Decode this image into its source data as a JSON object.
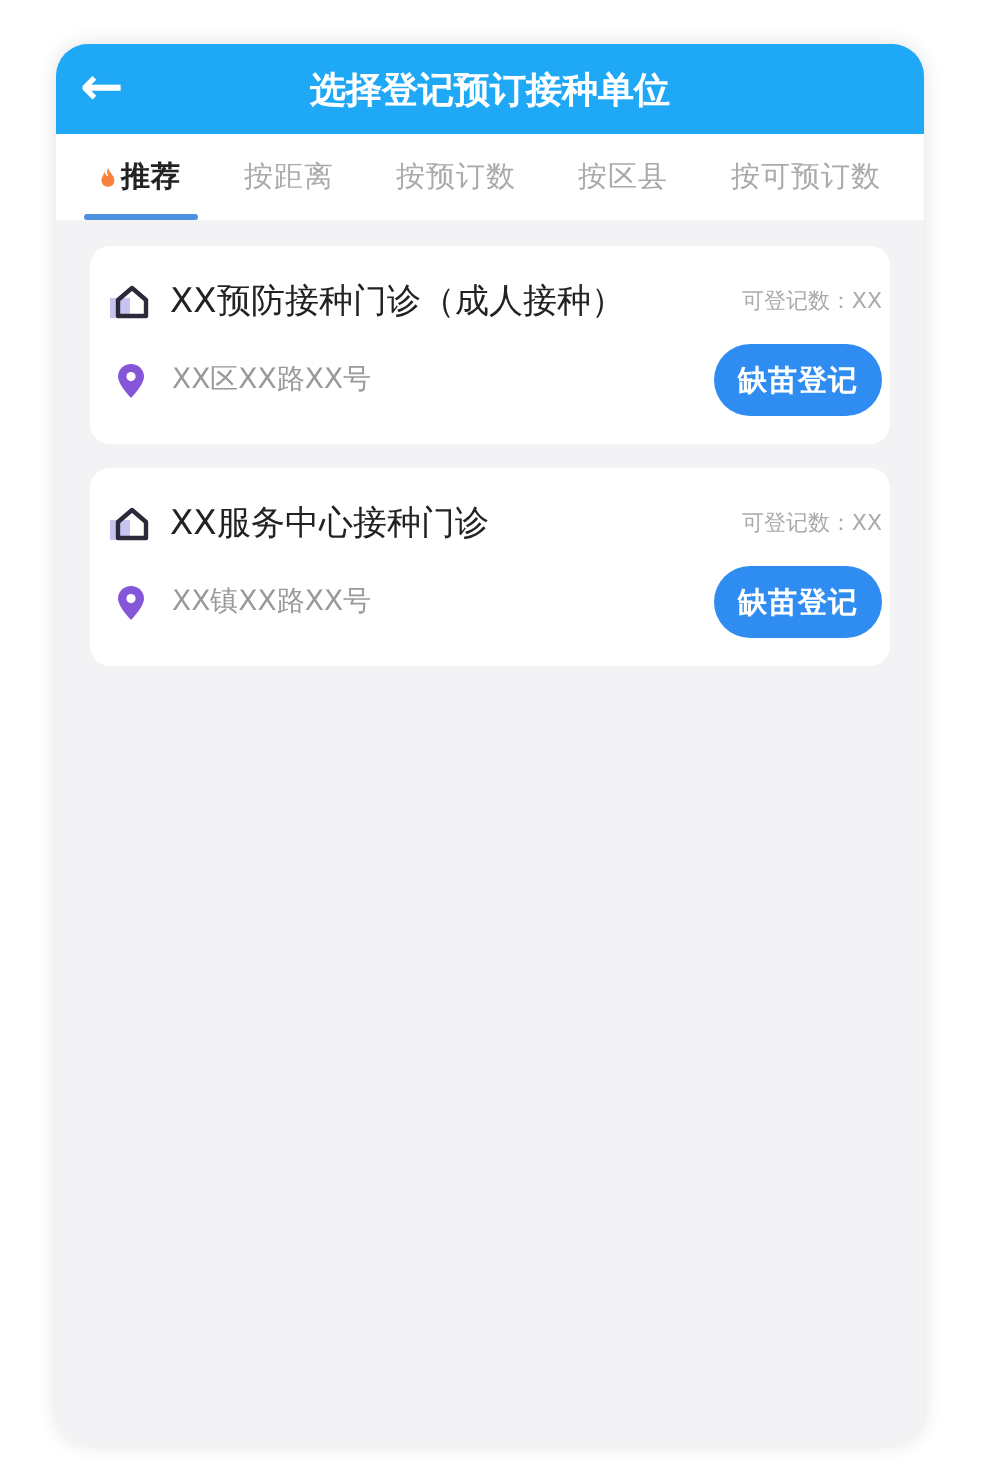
{
  "header": {
    "back": "←",
    "title": "选择登记预订接种单位"
  },
  "tabs": [
    {
      "label": "推荐",
      "selected": true,
      "hot": true
    },
    {
      "label": "按距离",
      "selected": false,
      "hot": false
    },
    {
      "label": "按预订数",
      "selected": false,
      "hot": false
    },
    {
      "label": "按区县",
      "selected": false,
      "hot": false
    },
    {
      "label": "按可预订数",
      "selected": false,
      "hot": false
    }
  ],
  "sites": [
    {
      "name": "XX预防接种门诊（成人接种）",
      "count": "可登记数：XX",
      "address": "XX区XX路XX号",
      "button": "缺苗登记"
    },
    {
      "name": "XX服务中心接种门诊",
      "count": "可登记数：XX",
      "address": "XX镇XX路XX号",
      "button": "缺苗登记"
    }
  ]
}
